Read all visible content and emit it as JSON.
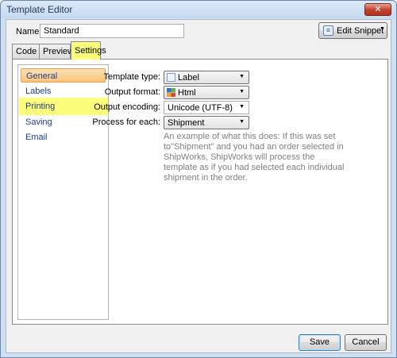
{
  "window": {
    "title": "Template Editor",
    "close_glyph": "✕"
  },
  "name_field": {
    "label": "Name:",
    "value": "Standard"
  },
  "edit_snippet": {
    "label": "Edit Snippet",
    "icon": "snippet-icon",
    "icon_glyph": "≡",
    "arrow": "▼"
  },
  "tabs": [
    {
      "label": "Code",
      "selected": false
    },
    {
      "label": "Preview",
      "selected": false
    },
    {
      "label": "Settings",
      "selected": true
    }
  ],
  "sidebar": {
    "items": [
      {
        "label": "General",
        "selected": true
      },
      {
        "label": "Labels",
        "selected": false
      },
      {
        "label": "Printing",
        "selected": false,
        "highlighted": true
      },
      {
        "label": "Saving",
        "selected": false
      },
      {
        "label": "Email",
        "selected": false
      }
    ]
  },
  "settings": {
    "template_type": {
      "label": "Template type:",
      "value": "Label",
      "icon": "label-icon"
    },
    "output_format": {
      "label": "Output format:",
      "value": "Html",
      "icon": "html-icon"
    },
    "output_encoding": {
      "label": "Output encoding:",
      "value": "Unicode (UTF-8)"
    },
    "process_for_each": {
      "label": "Process for each:",
      "value": "Shipment"
    },
    "help_text": "An example of what this does: If this was set to\"Shipment\" and you had an order selected in ShipWorks, ShipWorks will process the template as if you had selected each individual shipment in the order."
  },
  "dropdown_arrow": "▼",
  "buttons": {
    "save": "Save",
    "cancel": "Cancel"
  },
  "colors": {
    "highlight": "#fcfc7b",
    "selection": "#fbc37a",
    "link": "#1c3f8c"
  }
}
